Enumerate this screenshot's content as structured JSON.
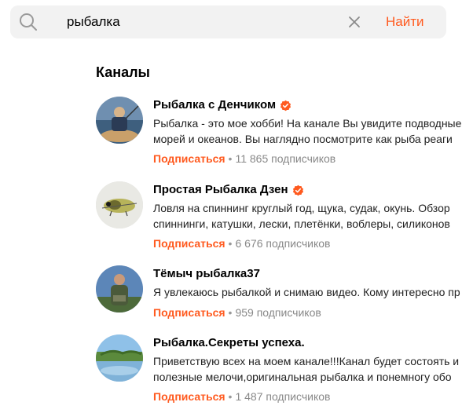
{
  "search": {
    "value": "рыбалка",
    "submit_label": "Найти"
  },
  "section": {
    "title": "Каналы"
  },
  "subscribe_label": "Подписаться",
  "accent_color": "#ff5a1f",
  "channels": [
    {
      "name": "Рыбалка с Денчиком",
      "verified": true,
      "desc_line1": "Рыбалка - это мое хобби! На канале Вы увидите подводные",
      "desc_line2": "морей и океанов. Вы наглядно посмотрите как рыба реаги",
      "subscribers": "11 865 подписчиков"
    },
    {
      "name": "Простая Рыбалка Дзен",
      "verified": true,
      "desc_line1": "Ловля на спиннинг круглый год, щука, судак, окунь. Обзор",
      "desc_line2": "спиннинги, катушки, лески, плетёнки, воблеры, силиконов",
      "subscribers": "6 676 подписчиков"
    },
    {
      "name": "Тёмыч рыбалка37",
      "verified": false,
      "desc_line1": "Я увлекаюсь рыбалкой и снимаю видео. Кому интересно пр",
      "desc_line2": "",
      "subscribers": "959 подписчиков"
    },
    {
      "name": "Рыбалка.Секреты успеха.",
      "verified": false,
      "desc_line1": "Приветствую всех на моем канале!!!Канал будет состоять и",
      "desc_line2": "полезные мелочи,оригинальная рыбалка и понемногу обо",
      "subscribers": "1 487 подписчиков"
    }
  ]
}
